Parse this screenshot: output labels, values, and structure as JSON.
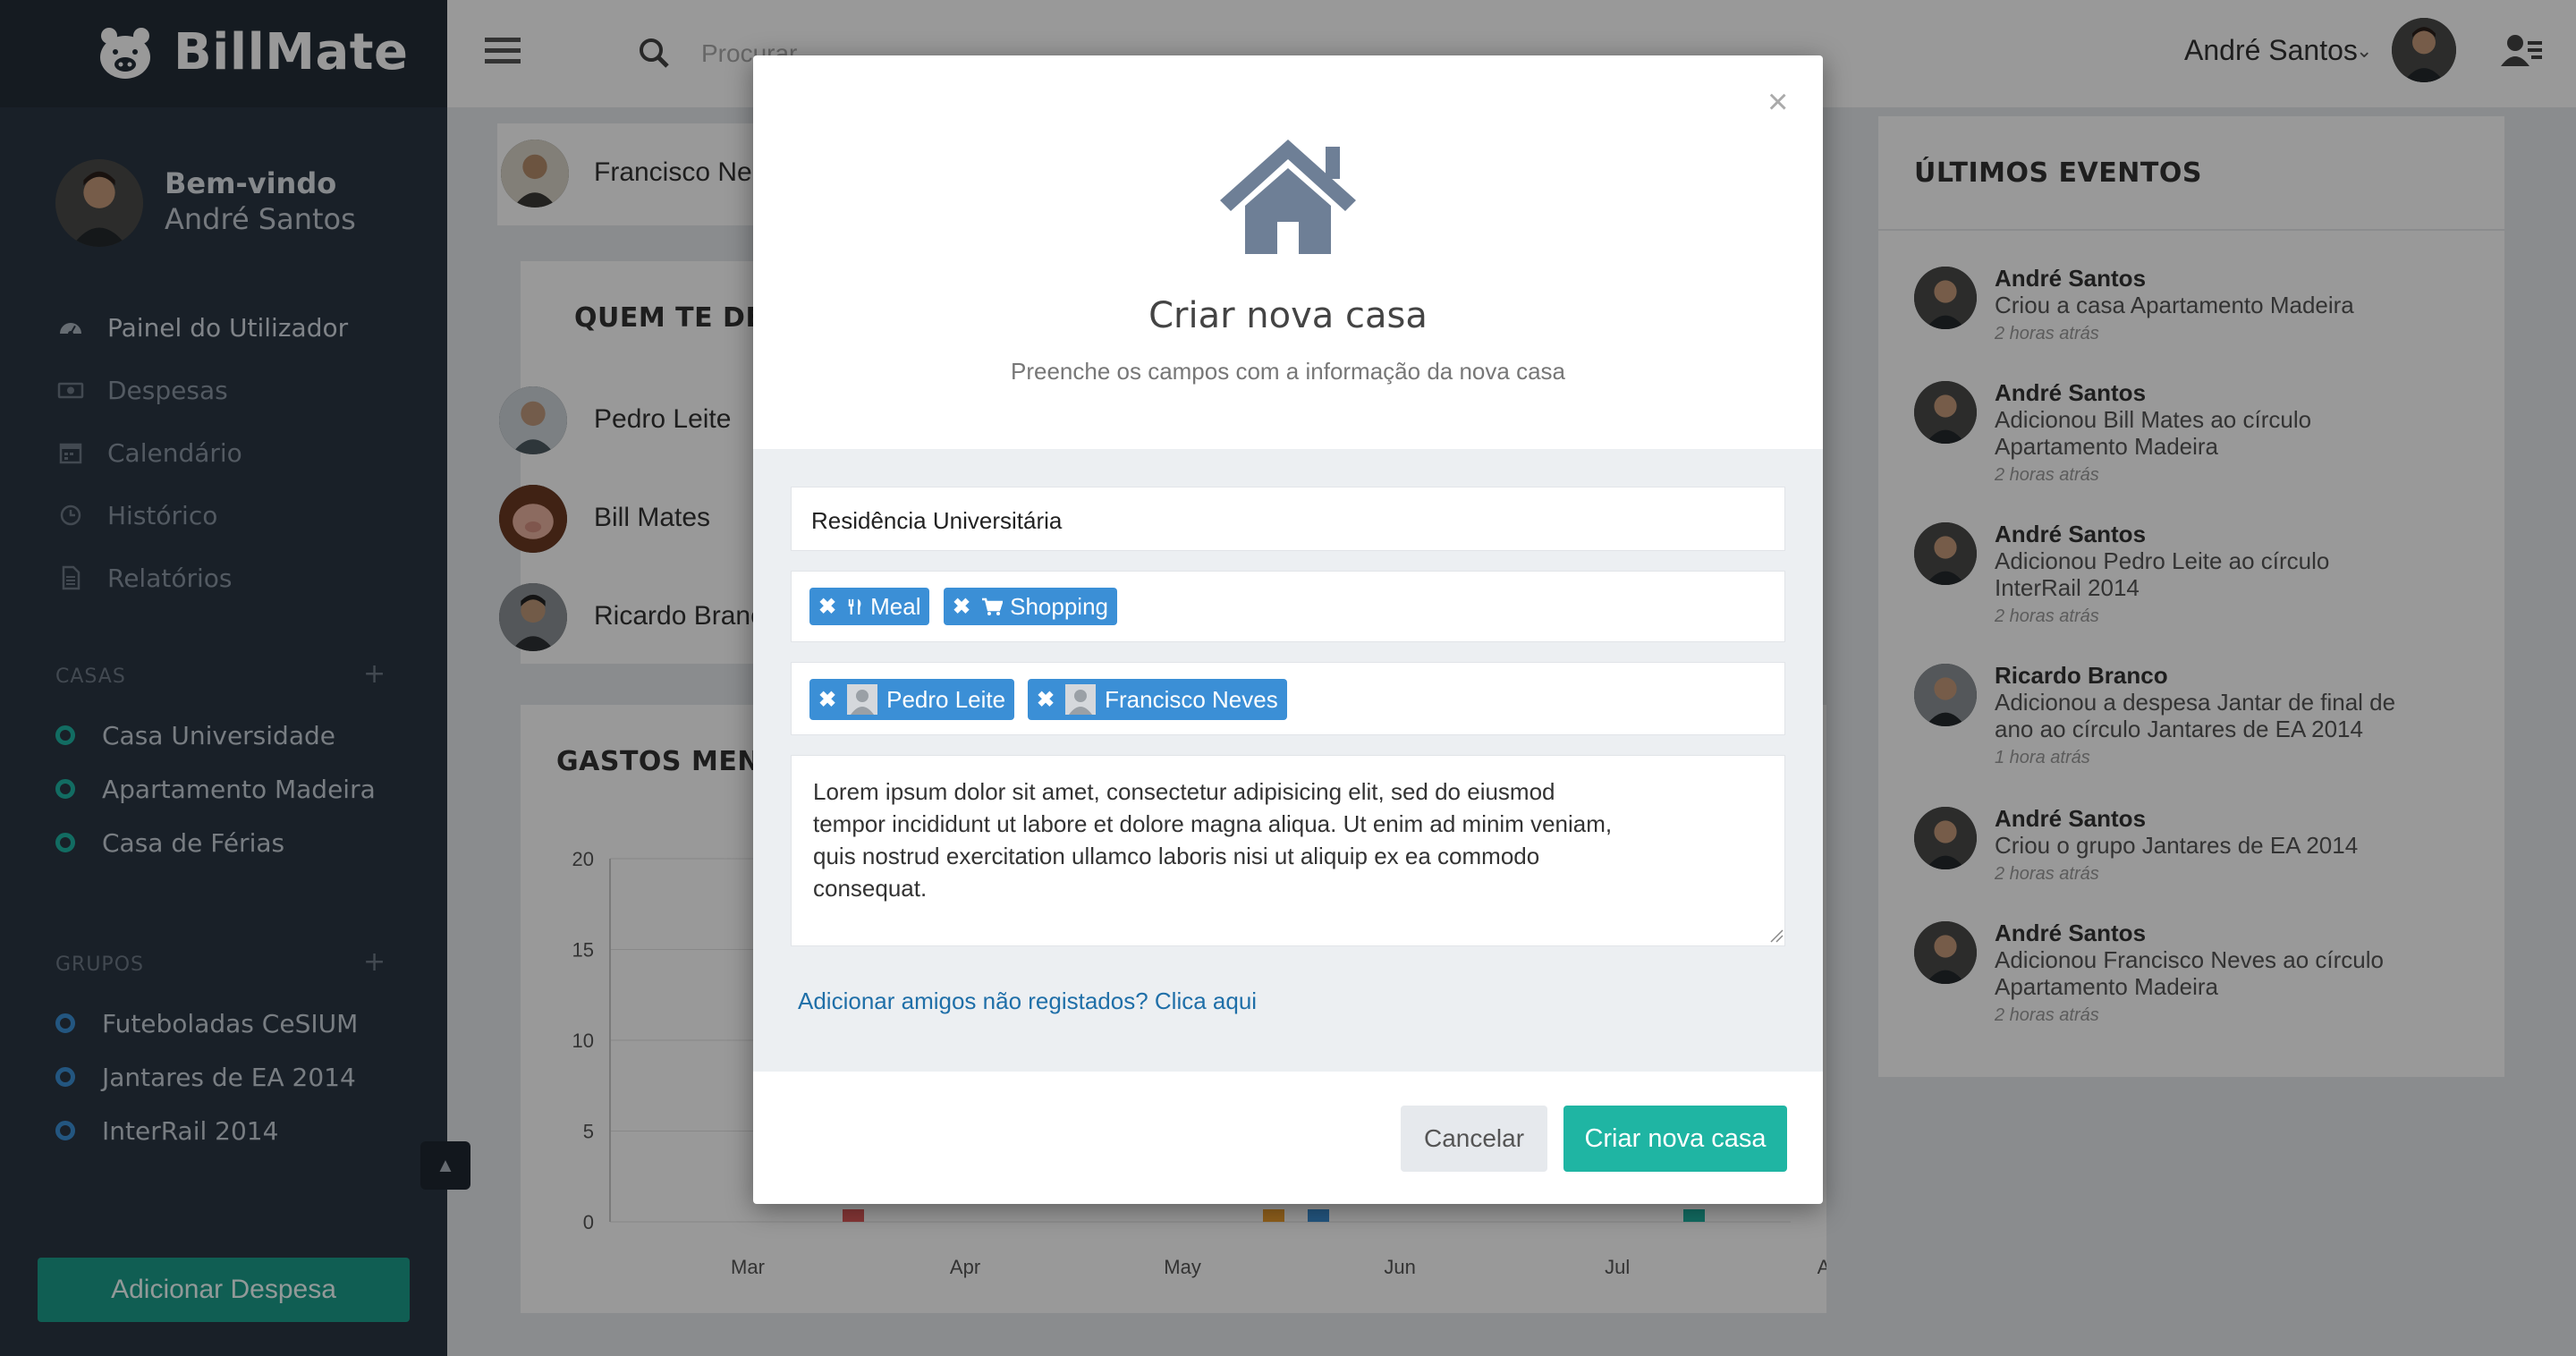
{
  "app": {
    "name": "BillMate"
  },
  "sidebar": {
    "welcome": "Bem-vindo",
    "user_name": "André Santos",
    "nav": [
      {
        "label": "Painel do Utilizador",
        "icon": "dashboard-icon"
      },
      {
        "label": "Despesas",
        "icon": "money-icon"
      },
      {
        "label": "Calendário",
        "icon": "calendar-icon"
      },
      {
        "label": "Histórico",
        "icon": "clock-icon"
      },
      {
        "label": "Relatórios",
        "icon": "file-icon"
      }
    ],
    "houses_title": "CASAS",
    "houses": [
      {
        "label": "Casa Universidade"
      },
      {
        "label": "Apartamento Madeira"
      },
      {
        "label": "Casa de Férias"
      }
    ],
    "groups_title": "GRUPOS",
    "groups": [
      {
        "label": "Futeboladas CeSIUM"
      },
      {
        "label": "Jantares de EA 2014"
      },
      {
        "label": "InterRail 2014"
      }
    ],
    "add_expense": "Adicionar Despesa",
    "plus": "+",
    "collapse": "▲",
    "colors": {
      "houses_ring": "#1fb5a3",
      "groups_ring": "#3b8fd6"
    }
  },
  "header": {
    "search_placeholder": "Procurar",
    "user_name": "André Santos",
    "caret": "⌄"
  },
  "background": {
    "top_person": "Francisco Ne",
    "owe_title": "QUEM TE DEV",
    "owe_people": [
      "Pedro Leite",
      "Bill Mates",
      "Ricardo Branc"
    ],
    "chart_title": "GASTOS MENSA",
    "events_title": "ÚLTIMOS EVENTOS",
    "events": [
      {
        "name": "André Santos",
        "desc": "Criou a casa Apartamento Madeira",
        "time": "2 horas atrás"
      },
      {
        "name": "André Santos",
        "desc": "Adicionou Bill Mates ao círculo Apartamento Madeira",
        "time": "2 horas atrás"
      },
      {
        "name": "André Santos",
        "desc": "Adicionou Pedro Leite ao círculo InterRail 2014",
        "time": "2 horas atrás"
      },
      {
        "name": "Ricardo Branco",
        "desc": "Adicionou a despesa Jantar de final de ano ao círculo Jantares de EA 2014",
        "time": "1 hora atrás"
      },
      {
        "name": "André Santos",
        "desc": "Criou o grupo Jantares de EA 2014",
        "time": "2 horas atrás"
      },
      {
        "name": "André Santos",
        "desc": "Adicionou Francisco Neves ao círculo Apartamento Madeira",
        "time": "2 horas atrás"
      }
    ]
  },
  "chart_data": {
    "type": "bar",
    "title": "GASTOS MENSA",
    "categories": [
      "Mar",
      "Apr",
      "May",
      "Jun",
      "Jul",
      "Aug"
    ],
    "ylim": [
      0,
      20
    ],
    "yticks": [
      0,
      5,
      10,
      15,
      20
    ],
    "series_colors": [
      "#e05a5a",
      "#f0a030",
      "#3b8fd6",
      "#1fb5a3"
    ]
  },
  "modal": {
    "close": "×",
    "title": "Criar nova casa",
    "subtitle": "Preenche os campos com a informação da nova casa",
    "name_value": "Residência Universitária",
    "categories": [
      {
        "label": "Meal",
        "icon": "cutlery-icon"
      },
      {
        "label": "Shopping",
        "icon": "cart-icon"
      }
    ],
    "members": [
      {
        "label": "Pedro Leite"
      },
      {
        "label": "Francisco Neves"
      }
    ],
    "remove_symbol": "✖",
    "description": "Lorem ipsum dolor sit amet, consectetur adipisicing elit, sed do eiusmod\ntempor incididunt ut labore et dolore magna aliqua. Ut enim ad minim veniam,\nquis nostrud exercitation ullamco laboris nisi ut aliquip ex ea commodo\nconsequat.",
    "link_unregistered": "Adicionar amigos não registados? Clica aqui",
    "cancel": "Cancelar",
    "submit": "Criar nova casa",
    "colors": {
      "tag": "#3b8fd6",
      "submit": "#1fb5a3",
      "house_icon": "#6e7f96"
    }
  }
}
